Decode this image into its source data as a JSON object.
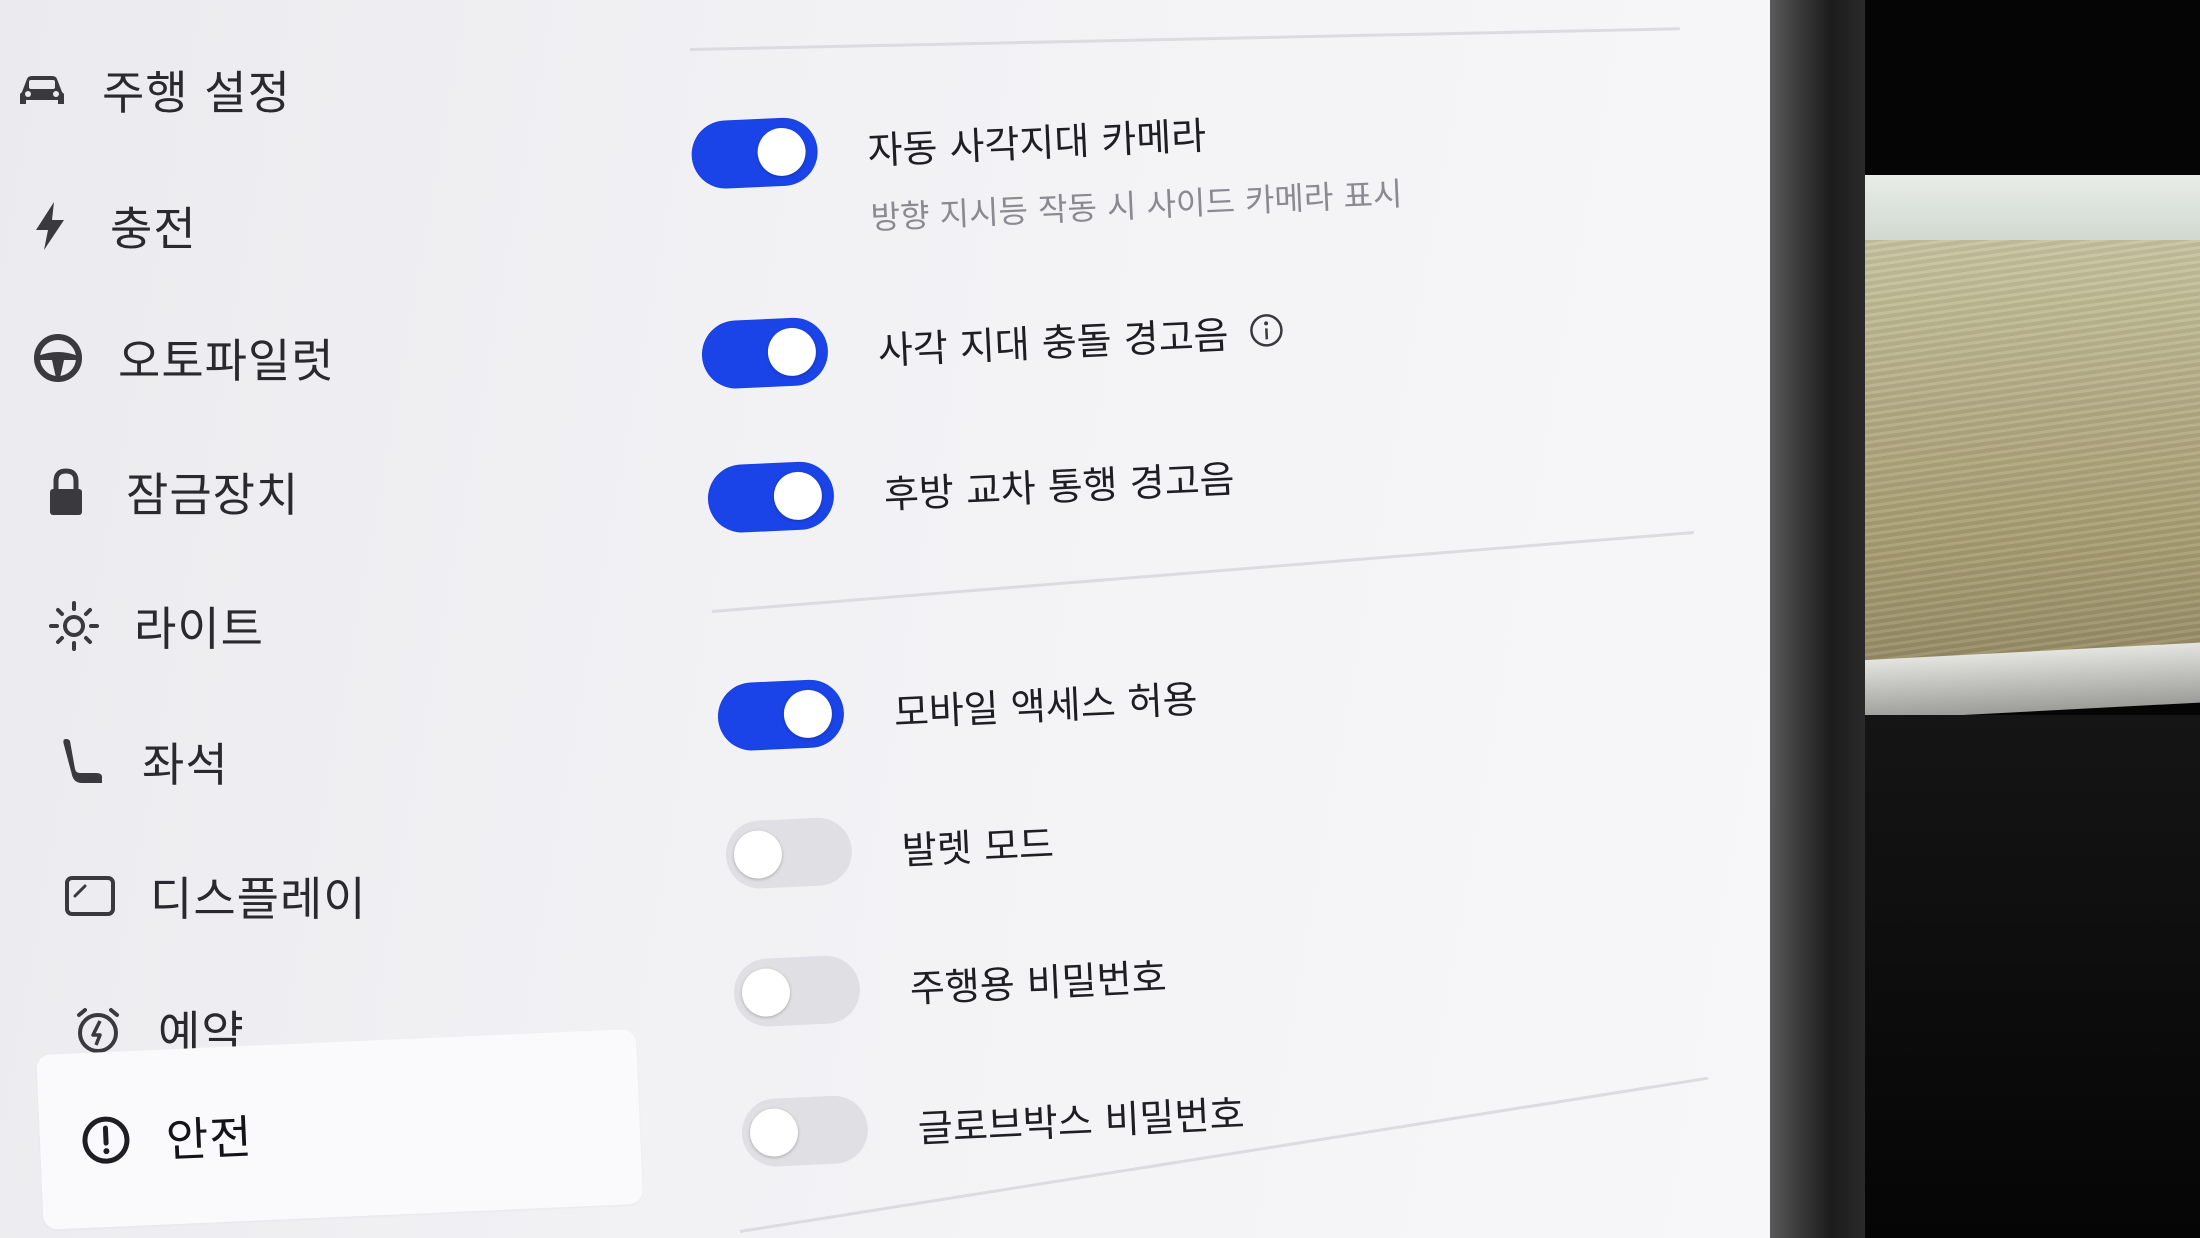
{
  "sidebar": {
    "items": [
      {
        "label": "주행 설정",
        "icon": "car-icon"
      },
      {
        "label": "충전",
        "icon": "lightning-icon"
      },
      {
        "label": "오토파일럿",
        "icon": "steering-wheel-icon"
      },
      {
        "label": "잠금장치",
        "icon": "lock-icon"
      },
      {
        "label": "라이트",
        "icon": "sun-icon"
      },
      {
        "label": "좌석",
        "icon": "seat-icon"
      },
      {
        "label": "디스플레이",
        "icon": "display-icon"
      },
      {
        "label": "예약",
        "icon": "alarm-clock-icon"
      },
      {
        "label": "안전",
        "icon": "alert-circle-icon",
        "active": true
      }
    ]
  },
  "settings": {
    "auto_blindspot_camera": {
      "title": "자동 사각지대 카메라",
      "subtitle": "방향 지시등 작동 시 사이드 카메라 표시",
      "on": true
    },
    "blindspot_collision_chime": {
      "title": "사각 지대 충돌 경고음",
      "on": true,
      "info_icon": "info-icon"
    },
    "rear_cross_traffic_chime": {
      "title": "후방 교차 통행 경고음",
      "on": true
    },
    "mobile_access": {
      "title": "모바일 액세스 허용",
      "on": true
    },
    "valet_mode": {
      "title": "발렛 모드",
      "on": false
    },
    "pin_to_drive": {
      "title": "주행용 비밀번호",
      "on": false
    },
    "glovebox_pin": {
      "title": "글로브박스 비밀번호",
      "on": false
    }
  },
  "colors": {
    "toggle_on": "#1a44e8",
    "toggle_off": "#e0e0e4",
    "screen_bg": "#f2f2f5",
    "active_item_bg": "#fafafc"
  }
}
